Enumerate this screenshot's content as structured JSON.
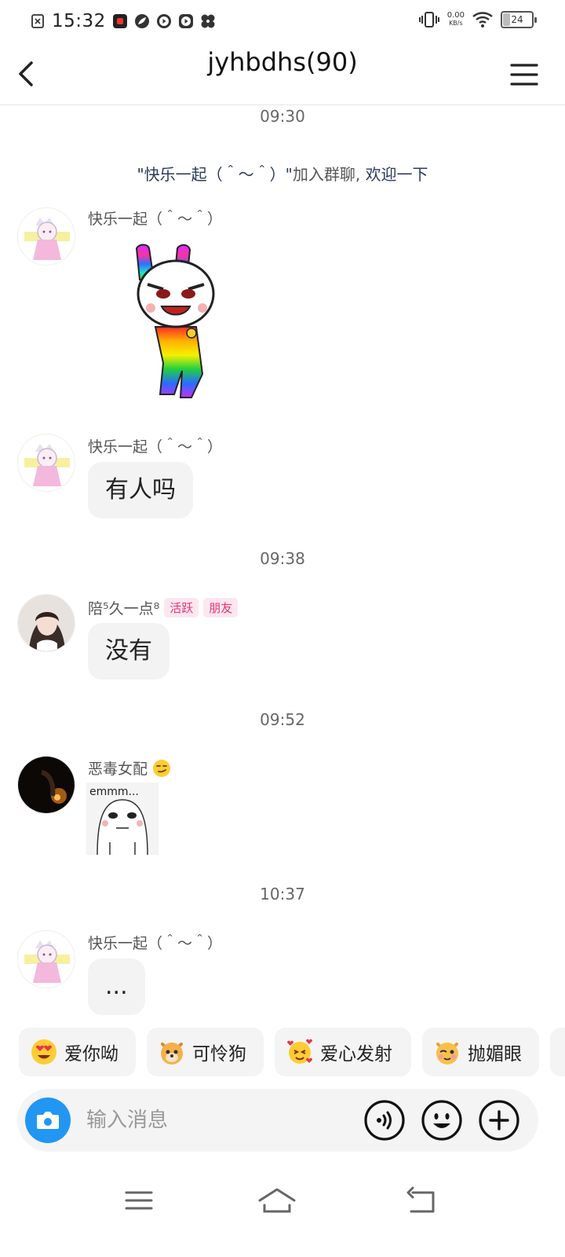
{
  "status_bar": {
    "time": "15:32",
    "net_speed_value": "0.00",
    "net_speed_unit": "KB/s",
    "battery": "24"
  },
  "header": {
    "title": "jyhbdhs(90)"
  },
  "chat": {
    "time_1": "09:30",
    "system_name": "\"快乐一起（＾～＾）\"",
    "system_text": "加入群聊,",
    "system_link": "欢迎一下",
    "msg1": {
      "sender": "快乐一起（＾～＾）"
    },
    "msg2": {
      "sender": "快乐一起（＾～＾）",
      "text": "有人吗"
    },
    "time_2": "09:38",
    "msg3": {
      "sender": "陪⁵久一点⁸",
      "tag_active": "活跃",
      "tag_friend": "朋友",
      "text": "没有"
    },
    "time_3": "09:52",
    "msg4": {
      "sender": "恶毒女配",
      "sticker_text": "emmm..."
    },
    "time_4": "10:37",
    "msg5": {
      "sender": "快乐一起（＾～＾）",
      "text": "..."
    }
  },
  "quick_emojis": [
    {
      "label": "爱你呦",
      "icon": "heart-eyes-emoji"
    },
    {
      "label": "可怜狗",
      "icon": "pitiful-dog-emoji"
    },
    {
      "label": "爱心发射",
      "icon": "love-launch-emoji"
    },
    {
      "label": "抛媚眼",
      "icon": "wink-emoji"
    }
  ],
  "input": {
    "placeholder": "输入消息"
  },
  "colors": {
    "accent": "#2196f3",
    "tag_text": "#e6347a",
    "tag_bg": "#fde7ef",
    "bubble_bg": "#f3f3f3"
  }
}
